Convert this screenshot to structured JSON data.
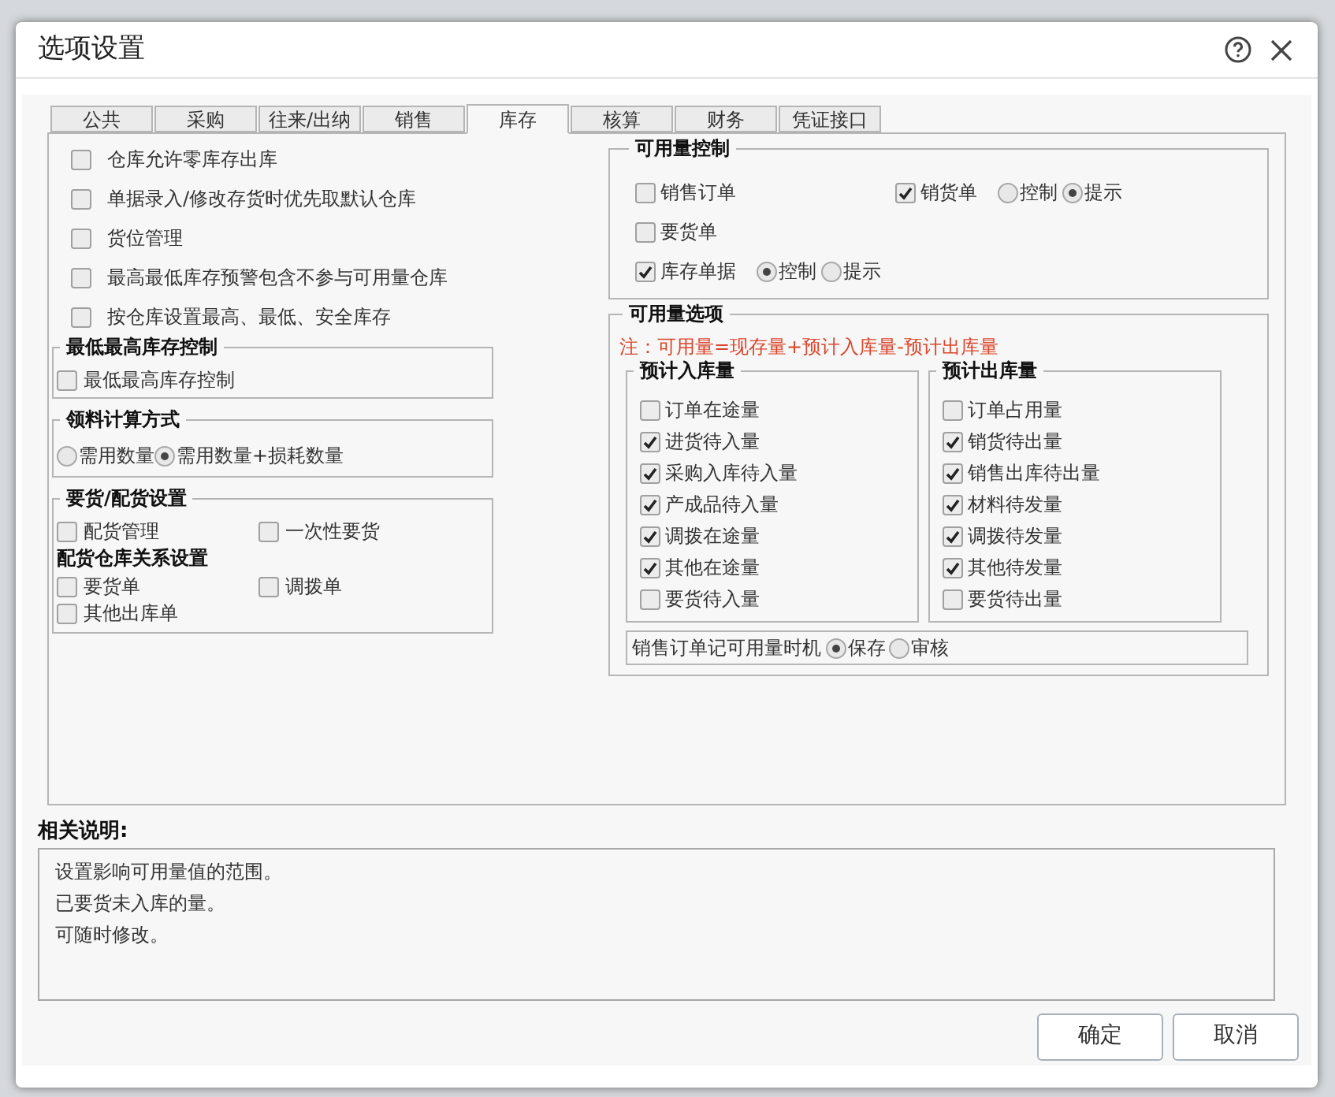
{
  "window": {
    "title": "选项设置"
  },
  "tabs": [
    {
      "label": "公共",
      "selected": false
    },
    {
      "label": "采购",
      "selected": false
    },
    {
      "label": "往来/出纳",
      "selected": false
    },
    {
      "label": "销售",
      "selected": false
    },
    {
      "label": "库存",
      "selected": true
    },
    {
      "label": "核算",
      "selected": false
    },
    {
      "label": "财务",
      "selected": false
    },
    {
      "label": "凭证接口",
      "selected": false
    }
  ],
  "general_options": [
    {
      "label": "仓库允许零库存出库",
      "checked": false
    },
    {
      "label": "单据录入/修改存货时优先取默认仓库",
      "checked": false
    },
    {
      "label": "货位管理",
      "checked": false
    },
    {
      "label": "最高最低库存预警包含不参与可用量仓库",
      "checked": false
    },
    {
      "label": "按仓库设置最高、最低、安全库存",
      "checked": false
    }
  ],
  "stock_limit_group": {
    "title": "最低最高库存控制",
    "options": [
      {
        "label": "最低最高库存控制",
        "checked": false
      }
    ]
  },
  "material_calc_group": {
    "title": "领料计算方式",
    "choices": [
      {
        "label": "需用数量",
        "selected": false
      },
      {
        "label": "需用数量+损耗数量",
        "selected": true
      }
    ]
  },
  "distribution_group": {
    "title": "要货/配货设置",
    "options": [
      {
        "label": "配货管理",
        "checked": false
      },
      {
        "label": "一次性要货",
        "checked": false
      }
    ],
    "subheading": "配货仓库关系设置",
    "relation_options": [
      {
        "label": "要货单",
        "checked": false
      },
      {
        "label": "调拨单",
        "checked": false
      },
      {
        "label": "其他出库单",
        "checked": false
      }
    ]
  },
  "availability_control": {
    "title": "可用量控制",
    "items": [
      {
        "label": "销售订单",
        "checked": false
      },
      {
        "label": "销货单",
        "checked": true,
        "modes": [
          {
            "label": "控制",
            "selected": false
          },
          {
            "label": "提示",
            "selected": true
          }
        ]
      },
      {
        "label": "要货单",
        "checked": false
      },
      {
        "label": "库存单据",
        "checked": true,
        "modes": [
          {
            "label": "控制",
            "selected": true
          },
          {
            "label": "提示",
            "selected": false
          }
        ]
      }
    ]
  },
  "availability_options": {
    "title": "可用量选项",
    "note": "注：可用量=现存量+预计入库量-预计出库量",
    "incoming": {
      "title": "预计入库量",
      "options": [
        {
          "label": "订单在途量",
          "checked": false
        },
        {
          "label": "进货待入量",
          "checked": true
        },
        {
          "label": "采购入库待入量",
          "checked": true
        },
        {
          "label": "产成品待入量",
          "checked": true
        },
        {
          "label": "调拨在途量",
          "checked": true
        },
        {
          "label": "其他在途量",
          "checked": true
        },
        {
          "label": "要货待入量",
          "checked": false
        }
      ]
    },
    "outgoing": {
      "title": "预计出库量",
      "options": [
        {
          "label": "订单占用量",
          "checked": false
        },
        {
          "label": "销货待出量",
          "checked": true
        },
        {
          "label": "销售出库待出量",
          "checked": true
        },
        {
          "label": "材料待发量",
          "checked": true
        },
        {
          "label": "调拨待发量",
          "checked": true
        },
        {
          "label": "其他待发量",
          "checked": true
        },
        {
          "label": "要货待出量",
          "checked": false
        }
      ]
    },
    "timing": {
      "label": "销售订单记可用量时机",
      "choices": [
        {
          "label": "保存",
          "selected": true
        },
        {
          "label": "审核",
          "selected": false
        }
      ]
    }
  },
  "notes": {
    "title": "相关说明:",
    "lines": [
      "设置影响可用量值的范围。",
      "已要货未入库的量。",
      "可随时修改。"
    ]
  },
  "buttons": [
    "确定",
    "取消"
  ]
}
